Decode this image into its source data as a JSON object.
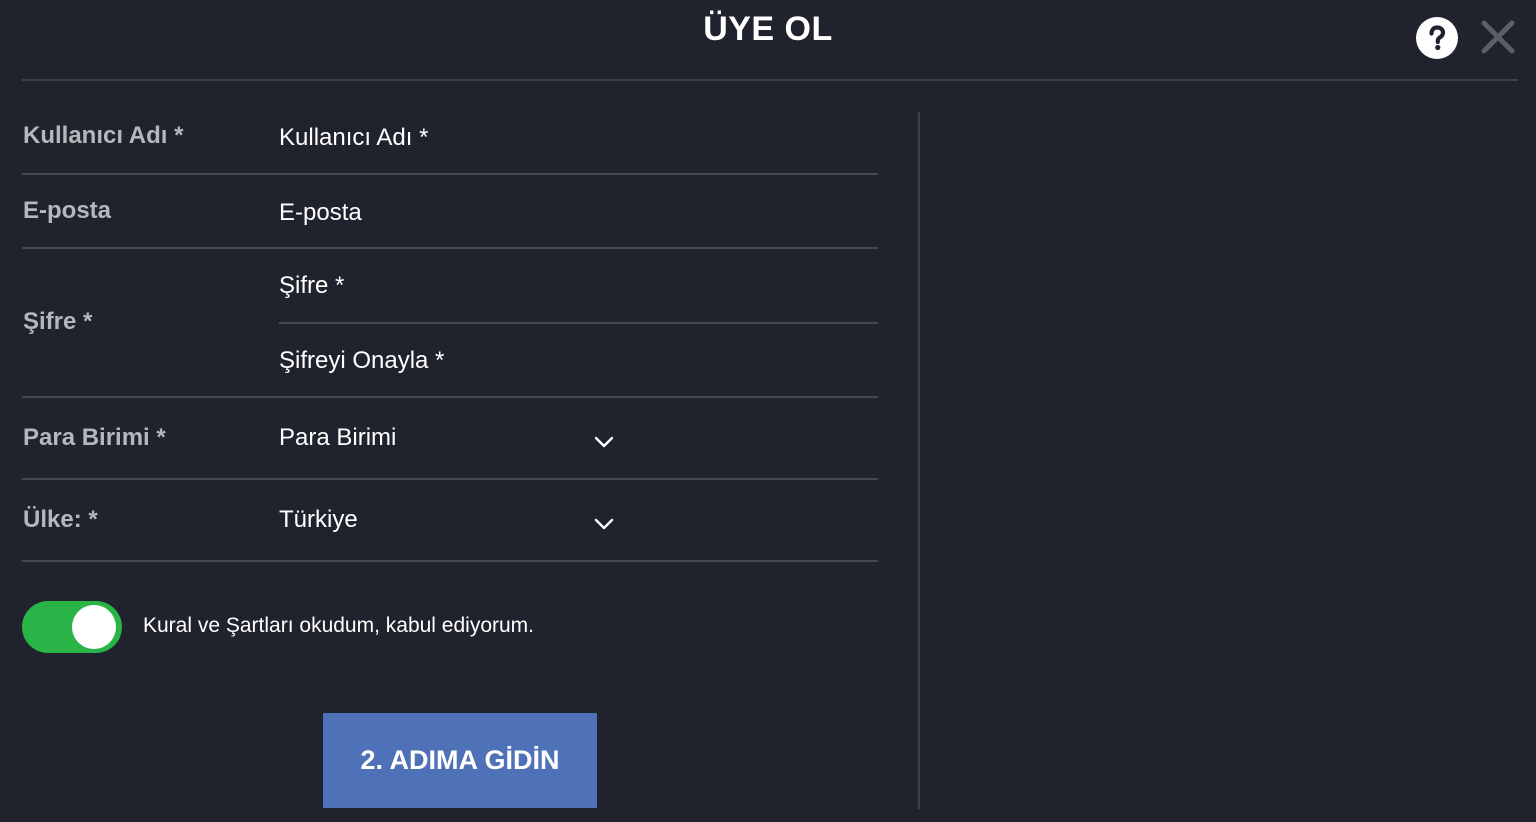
{
  "header": {
    "title": "ÜYE OL",
    "help_icon": "question-mark-icon",
    "close_icon": "close-icon"
  },
  "form": {
    "username": {
      "label": "Kullanıcı Adı *",
      "placeholder": "Kullanıcı Adı *"
    },
    "email": {
      "label": "E-posta",
      "placeholder": "E-posta"
    },
    "password": {
      "label": "Şifre *",
      "placeholder": "Şifre *",
      "confirm_placeholder": "Şifreyi Onayla *"
    },
    "currency": {
      "label": "Para Birimi *",
      "value": "Para Birimi",
      "icon": "chevron-down-icon"
    },
    "country": {
      "label": "Ülke: *",
      "value": "Türkiye",
      "icon": "chevron-down-icon"
    },
    "terms": {
      "label": "Kural ve Şartları okudum, kabul ediyorum.",
      "checked": true
    },
    "submit_label": "2. ADIMA GİDİN"
  },
  "colors": {
    "background": "#20232d",
    "toggle_on": "#2ab346",
    "button": "#4e71b7",
    "label": "#b5b7bb",
    "divider": "#454852"
  }
}
